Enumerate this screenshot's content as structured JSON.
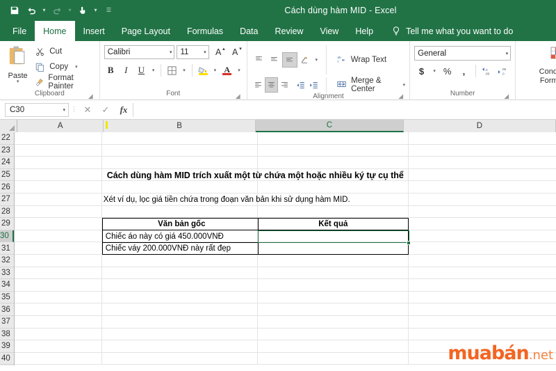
{
  "titlebar": {
    "document_title": "Cách dùng hàm MID  -  Excel",
    "quick_access": [
      {
        "name": "save-icon",
        "label": "Save"
      },
      {
        "name": "undo-icon",
        "label": "Undo"
      },
      {
        "name": "redo-icon",
        "label": "Redo"
      },
      {
        "name": "touch-mode-icon",
        "label": "Touch/Mouse Mode"
      },
      {
        "name": "customize-qat-icon",
        "label": "Customize Quick Access Toolbar"
      }
    ]
  },
  "tabs": [
    {
      "label": "File",
      "active": false
    },
    {
      "label": "Home",
      "active": true
    },
    {
      "label": "Insert",
      "active": false
    },
    {
      "label": "Page Layout",
      "active": false
    },
    {
      "label": "Formulas",
      "active": false
    },
    {
      "label": "Data",
      "active": false
    },
    {
      "label": "Review",
      "active": false
    },
    {
      "label": "View",
      "active": false
    },
    {
      "label": "Help",
      "active": false
    }
  ],
  "tell_me": "Tell me what you want to do",
  "ribbon": {
    "clipboard": {
      "group_label": "Clipboard",
      "paste_label": "Paste",
      "cut_label": "Cut",
      "copy_label": "Copy",
      "format_painter_label": "Format Painter"
    },
    "font": {
      "group_label": "Font",
      "font_name": "Calibri",
      "font_size": "11",
      "bold_label": "B",
      "italic_label": "I",
      "underline_label": "U",
      "grow_font_label": "A",
      "shrink_font_label": "A",
      "fill_color": "#ffdd00",
      "font_color": "#d93025"
    },
    "alignment": {
      "group_label": "Alignment",
      "wrap_text_label": "Wrap Text",
      "merge_center_label": "Merge & Center"
    },
    "number": {
      "group_label": "Number",
      "format_value": "General",
      "currency_label": "$",
      "percent_label": "%",
      "comma_label": ","
    },
    "styles": {
      "conditional_formatting_label": "Conditional Formatting"
    }
  },
  "formula_bar": {
    "name_box": "C30",
    "cancel_label": "✕",
    "enter_label": "✓",
    "fx_label": "fx",
    "formula_value": ""
  },
  "grid": {
    "columns": [
      "A",
      "B",
      "C",
      "D"
    ],
    "selected_column": "C",
    "selected_row": "30",
    "active_cell": "C30",
    "rows": [
      "22",
      "23",
      "24",
      "25",
      "26",
      "27",
      "28",
      "29",
      "30",
      "31",
      "32",
      "33",
      "34",
      "35",
      "36",
      "37",
      "38",
      "39",
      "40"
    ],
    "content": {
      "heading": "Cách dùng hàm MID trích xuất một từ chứa một hoặc nhiều ký tự cụ thể",
      "subtitle": "Xét ví dụ, lọc giá tiền chứa trong đoạn văn bản khi sử dụng hàm MID.",
      "table": {
        "headers": [
          "Văn bản gốc",
          "Kết quả"
        ],
        "rows": [
          {
            "source": "Chiếc áo này có giá 450.000VNĐ",
            "result": ""
          },
          {
            "source": "Chiếc váy 200.000VNĐ này rất đẹp",
            "result": ""
          }
        ]
      }
    }
  },
  "watermark": {
    "main": "muabán",
    "suffix": ".net"
  }
}
